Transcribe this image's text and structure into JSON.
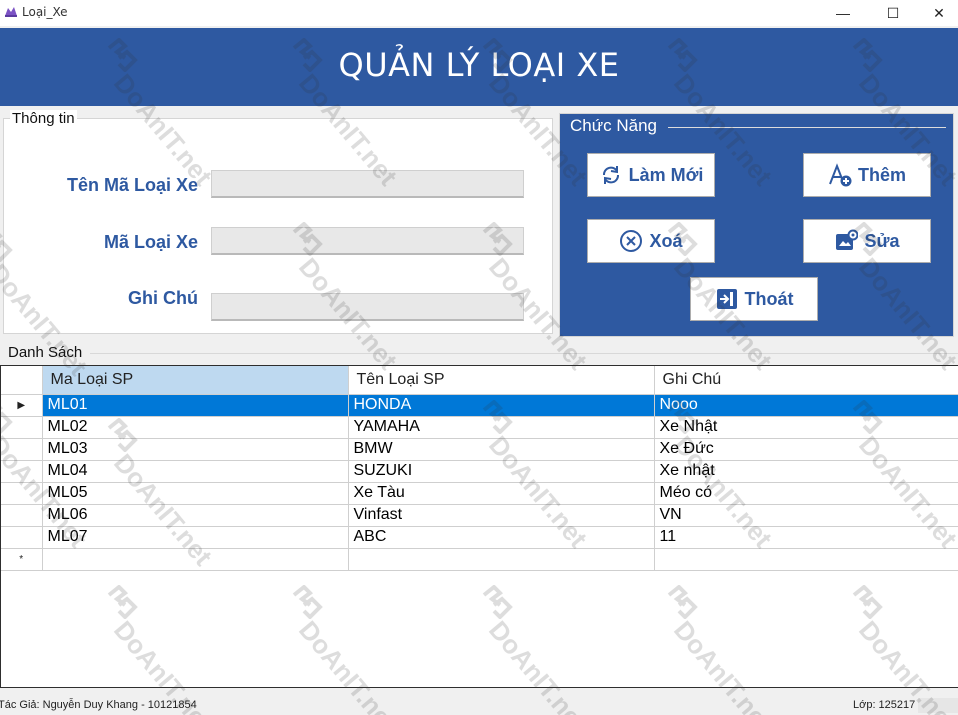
{
  "window": {
    "title": "Loại_Xe",
    "controls": {
      "minimize": "—",
      "maximize": "☐",
      "close": "✕"
    }
  },
  "header": {
    "heading": "QUẢN LÝ LOẠI XE"
  },
  "info": {
    "legend": "Thông tin",
    "fields": [
      {
        "label": "Tên Mã Loại Xe",
        "value": ""
      },
      {
        "label": "Mã Loại Xe",
        "value": ""
      },
      {
        "label": "Ghi Chú",
        "value": ""
      }
    ]
  },
  "functions": {
    "legend": "Chức Năng",
    "buttons": [
      {
        "label": "Làm Mới",
        "icon": "refresh-icon"
      },
      {
        "label": "Thêm",
        "icon": "add-text-icon"
      },
      {
        "label": "Xoá",
        "icon": "delete-circle-icon"
      },
      {
        "label": "Sửa",
        "icon": "edit-settings-icon"
      },
      {
        "label": "Thoát",
        "icon": "exit-icon"
      }
    ]
  },
  "list": {
    "label": "Danh Sách",
    "columns": [
      "Ma Loại SP",
      "Tên Loại SP",
      "Ghi Chú"
    ],
    "rows": [
      [
        "ML01",
        "HONDA",
        "Nooo"
      ],
      [
        "ML02",
        "YAMAHA",
        "Xe Nhật"
      ],
      [
        "ML03",
        "BMW",
        "Xe Đức"
      ],
      [
        "ML04",
        "SUZUKI",
        "Xe nhật"
      ],
      [
        "ML05",
        "Xe Tàu",
        "Méo có"
      ],
      [
        "ML06",
        "Vinfast",
        "VN"
      ],
      [
        "ML07",
        "ABC",
        "11"
      ]
    ],
    "selected_row_marker": "▶",
    "new_row_marker": "*"
  },
  "status": {
    "author": "Tác Giả: Nguyễn Duy Khang - 10121854",
    "class": "Lớp: 125217"
  },
  "watermark": {
    "text": "DoAnIT.net"
  },
  "colors": {
    "primary": "#2e59a1",
    "selection": "#0078d7",
    "header_selected": "#bed9f0"
  }
}
